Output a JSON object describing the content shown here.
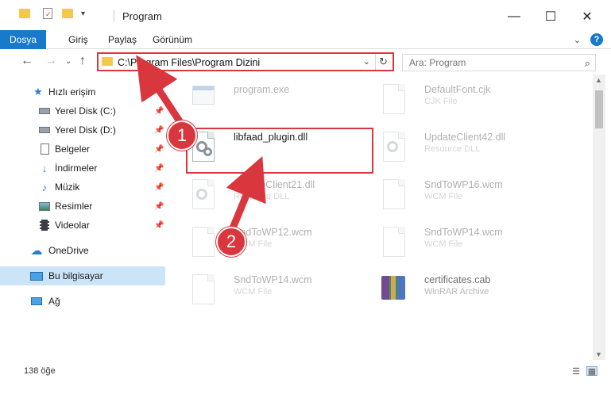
{
  "window": {
    "title": "Program",
    "controls": {
      "minimize": "—",
      "maximize": "☐",
      "close": "✕"
    }
  },
  "ribbon": {
    "file_tab": "Dosya",
    "tabs": [
      "Giriş",
      "Paylaş",
      "Görünüm"
    ],
    "help": "?"
  },
  "navigation": {
    "address": "C:\\Program Files\\Program Dizini",
    "search_placeholder": "Ara: Program"
  },
  "sidebar": {
    "quick_access": "Hızlı erişim",
    "items": [
      {
        "label": "Yerel Disk (C:)",
        "icon": "drive-icon",
        "pinned": true
      },
      {
        "label": "Yerel Disk (D:)",
        "icon": "drive-icon",
        "pinned": true
      },
      {
        "label": "Belgeler",
        "icon": "documents-icon",
        "pinned": true
      },
      {
        "label": "İndirmeler",
        "icon": "downloads-icon",
        "pinned": true
      },
      {
        "label": "Müzik",
        "icon": "music-icon",
        "pinned": true
      },
      {
        "label": "Resimler",
        "icon": "pictures-icon",
        "pinned": true
      },
      {
        "label": "Videolar",
        "icon": "videos-icon",
        "pinned": true
      }
    ],
    "onedrive": "OneDrive",
    "this_pc": "Bu bilgisayar",
    "network": "Ağ"
  },
  "files": [
    {
      "name": "program.exe",
      "type": "",
      "icon": "exe-icon"
    },
    {
      "name": "DefaultFont.cjk",
      "type": "CJK File",
      "icon": "document-icon"
    },
    {
      "name": "libfaad_plugin.dll",
      "type": "",
      "icon": "dll-icon"
    },
    {
      "name": "UpdateClient42.dll",
      "type": "Resource DLL",
      "icon": "dll-icon"
    },
    {
      "name": "UpdateClient21.dll",
      "type": "Resource DLL",
      "icon": "dll-icon"
    },
    {
      "name": "SndToWP16.wcm",
      "type": "WCM File",
      "icon": "document-icon"
    },
    {
      "name": "SndToWP12.wcm",
      "type": "WCM File",
      "icon": "document-icon"
    },
    {
      "name": "SndToWP14.wcm",
      "type": "WCM File",
      "icon": "document-icon"
    },
    {
      "name": "SndToWP14.wcm",
      "type": "WCM File",
      "icon": "document-icon"
    },
    {
      "name": "certificates.cab",
      "type": "WinRAR Archive",
      "icon": "archive-icon"
    }
  ],
  "status": {
    "item_count": "138 öğe"
  },
  "annotations": {
    "step1": "1",
    "step2": "2"
  },
  "colors": {
    "accent": "#1979ca",
    "highlight": "#d9363e",
    "selected": "#cce4f7"
  }
}
